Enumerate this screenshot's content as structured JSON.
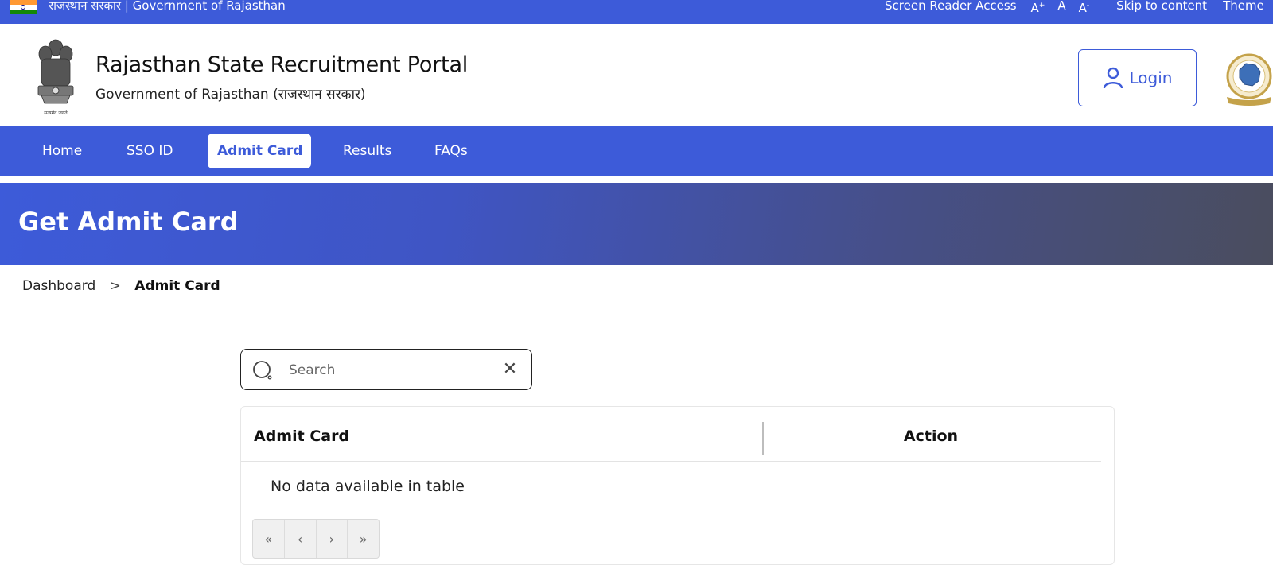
{
  "topbar": {
    "gov_label": "राजस्थान सरकार | Government of Rajasthan",
    "screen_reader": "Screen Reader Access",
    "font_increase": "A",
    "font_increase_mark": "+",
    "font_normal": "A",
    "font_decrease": "A",
    "font_decrease_mark": "-",
    "skip": "Skip to content",
    "theme": "Theme"
  },
  "header": {
    "title": "Rajasthan State Recruitment Portal",
    "subtitle": "Government of Rajasthan (राजस्थान सरकार)",
    "emblem_motto": "सत्यमेव जयते",
    "login_label": "Login"
  },
  "nav": {
    "items": [
      {
        "label": "Home"
      },
      {
        "label": "SSO ID"
      },
      {
        "label": "Admit Card",
        "active": true
      },
      {
        "label": "Results"
      },
      {
        "label": "FAQs"
      }
    ]
  },
  "banner": {
    "title": "Get Admit Card"
  },
  "breadcrumb": {
    "parent": "Dashboard",
    "separator": ">",
    "current": "Admit Card"
  },
  "search": {
    "placeholder": "Search",
    "value": ""
  },
  "table": {
    "columns": [
      "Admit Card",
      "Action"
    ],
    "empty_message": "No data available in table"
  },
  "pager": {
    "first": "«",
    "prev": "‹",
    "next": "›",
    "last": "»"
  },
  "colors": {
    "brand_blue": "#3d5bd9",
    "banner_end": "#4a4d5e"
  },
  "icons": {
    "flag": "india-flag-icon",
    "emblem": "ashoka-emblem-icon",
    "login": "user-icon",
    "right_logo": "rajasthan-map-seal-icon",
    "search": "search-icon",
    "clear": "close-icon"
  }
}
